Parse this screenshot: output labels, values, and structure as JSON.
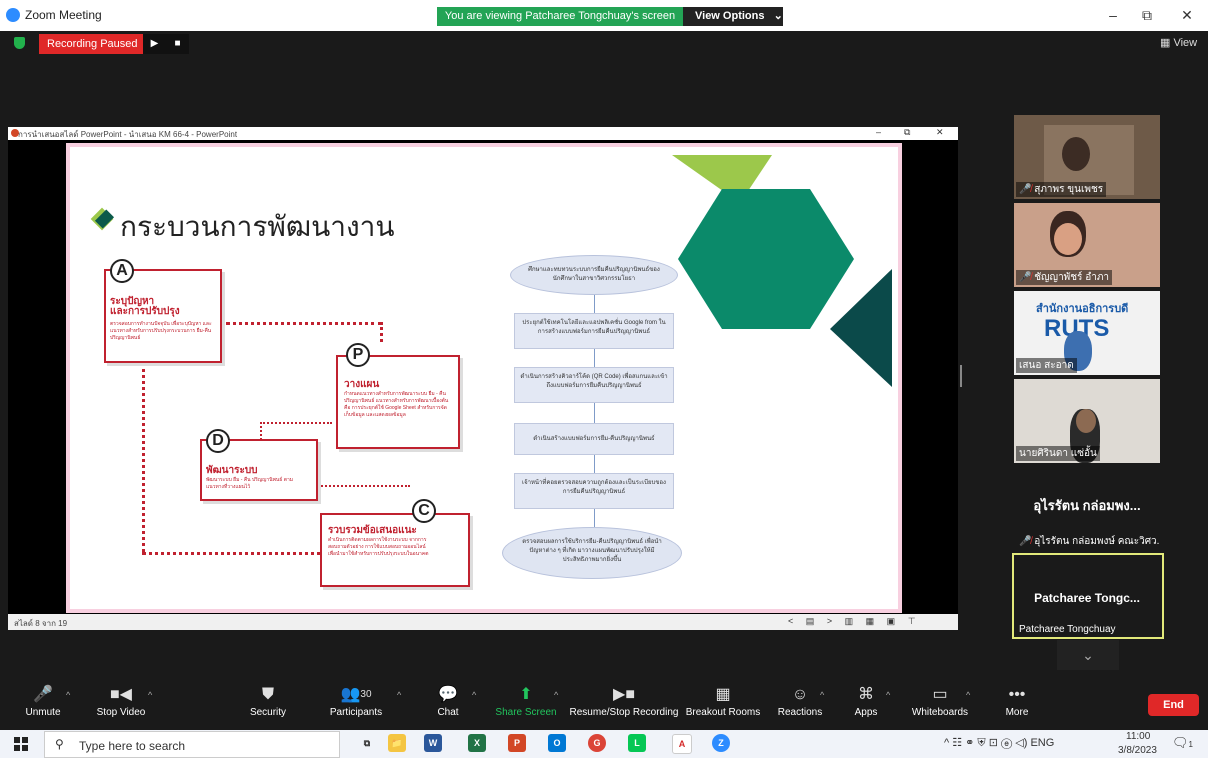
{
  "window": {
    "title": "Zoom Meeting",
    "minimize": "–",
    "restore": "⧉",
    "close": "✕"
  },
  "share_banner": {
    "text": "You are viewing Patcharee Tongchuay's screen",
    "view_options": "View Options",
    "chevron": "⌄"
  },
  "recording": {
    "status": "Recording Paused",
    "play": "▶",
    "stop": "■"
  },
  "view_button": "View",
  "ppt": {
    "title": "การนำเสนอสไลด์ PowerPoint - นำเสนอ KM 66-4 - PowerPoint",
    "minimize": "–",
    "restore": "⧉",
    "close": "✕",
    "status_left": "สไลด์ 8 จาก 19",
    "status_icons": [
      "<",
      "▤",
      ">",
      "▥",
      "▦",
      "▣",
      "⊤"
    ]
  },
  "slide": {
    "title": "กระบวนการพัฒนางาน",
    "steps": [
      {
        "letter": "A",
        "head": "ระบุปัญหา\nและการปรับปรุง",
        "body": "ตรวจสอบการทำงานปัจจุบัน เพื่อระบุปัญหา และแนวทางสำหรับการปรับปรุงกระบวนการ ยืม-คืน ปริญญานิพนธ์"
      },
      {
        "letter": "P",
        "head": "วางแผน",
        "body": "กำหนดแนวทางสำหรับการพัฒนาระบบ ยืม - คืน ปริญญานิพนธ์ แนวทางสำหรับการพัฒนาเบื้องต้น คือ การประยุกต์ใช้ Google Sheet สำหรับการจัดเก็บข้อมูล และแสดงผลข้อมูล"
      },
      {
        "letter": "D",
        "head": "พัฒนาระบบ",
        "body": "พัฒนาระบบ ยืม - คืน ปริญญานิพนธ์ ตามแนวทางที่วางแผนไว้"
      },
      {
        "letter": "C",
        "head": "รวบรวมข้อเสนอแนะ",
        "body": "ดำเนินการติดตามผลการใช้งานระบบ จากการสอบถามตัวอย่าง การใช้แบบสอบถามออนไลน์ เพื่อนำมาใช้สำหรับการปรับปรุงระบบในอนาคต"
      }
    ],
    "flow": [
      "ศึกษาและทบทวนระบบการยืมคืนปริญญานิพนธ์ของนักศึกษาในสาขาวิศวกรรมโยธา",
      "ประยุกต์ใช้เทคโนโลยีและแอปพลิเคชั่น Google from ในการสร้างแบบฟอร์มการยืมคืนปริญญานิพนธ์",
      "ดำเนินการสร้างคิวอาร์โค้ด (QR Code) เพื่อสแกนและเข้าถึงแบบฟอร์มการยืมคืนปริญญานิพนธ์",
      "ดำเนินสร้างแบบฟอร์มการยืม-คืนปริญญานิพนธ์",
      "เจ้าหน้าที่คอยตรวจสอบความถูกต้องและเป็นระเบียบของการยืมคืนปริญญานิพนธ์",
      "ตรวจสอบผลการใช้บริการยืม-คืนปริญญานิพนธ์ เพื่อนำปัญหาต่าง ๆ ที่เกิด มาวางแผนพัฒนาปรับปรุงให้มีประสิทธิภาพมากยิ่งขึ้น"
    ],
    "colors": {
      "red": "#c0212f",
      "teal": "#0b8a6a",
      "lime": "#9cc84b",
      "dark_teal": "#0b4a4a"
    }
  },
  "participants": [
    {
      "name": "สุภาพร ขุนเพชร",
      "muted": true
    },
    {
      "name": "ชัญญาพัชร์ อำภา",
      "muted": true
    },
    {
      "name": "เสนอ สะอาด",
      "muted": false,
      "logo": "สำนักงานอธิการบดี",
      "logo_mark": "RUTS"
    },
    {
      "name": "นายศิรินดา แซ่อั้น",
      "muted": false
    },
    {
      "name": "อุไรรัตน กล่อมพงษ์ คณะวิศว...",
      "big": "อุไรรัตน กล่อมพง...",
      "muted": true
    },
    {
      "name": "Patcharee Tongchuay",
      "big": "Patcharee Tongc..."
    }
  ],
  "chevron_down": "⌄",
  "toolbar": {
    "items": [
      {
        "label": "Unmute",
        "icon": "🎤"
      },
      {
        "label": "Stop Video",
        "icon": "■◀"
      },
      {
        "label": "Security",
        "icon": "⛊"
      },
      {
        "label": "Participants",
        "icon": "👥",
        "count": "30"
      },
      {
        "label": "Chat",
        "icon": "💬"
      },
      {
        "label": "Share Screen",
        "icon": "⬆"
      },
      {
        "label": "Resume/Stop Recording",
        "icon": "▶■"
      },
      {
        "label": "Breakout Rooms",
        "icon": "▦"
      },
      {
        "label": "Reactions",
        "icon": "☺"
      },
      {
        "label": "Apps",
        "icon": "⌘"
      },
      {
        "label": "Whiteboards",
        "icon": "▭"
      },
      {
        "label": "More",
        "icon": "•••"
      }
    ],
    "caret": "^",
    "end": "End",
    "share_color": "#22c55e"
  },
  "taskbar": {
    "search_placeholder": "Type here to search",
    "apps": [
      "⧉",
      "📁",
      "W",
      "X",
      "P",
      "O",
      "G",
      "L",
      "A",
      "Z"
    ],
    "tray": "^ ☷ ⚭ ⛨ ⊡ ⓔ ◁) ENG",
    "time": "11:00",
    "date": "3/8/2023",
    "notification": "1"
  }
}
